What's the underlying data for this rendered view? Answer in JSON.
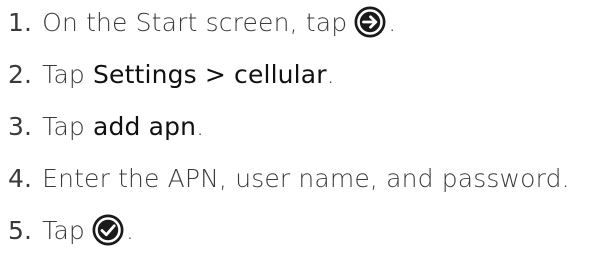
{
  "steps": [
    {
      "number": "1.",
      "text_before": "On the Start screen, tap",
      "icon": "arrow-right-circle-icon",
      "text_after": "."
    },
    {
      "number": "2.",
      "text_before": "Tap ",
      "emphasis": "Settings > cellular",
      "text_after": "."
    },
    {
      "number": "3.",
      "text_before": "Tap ",
      "emphasis": "add apn",
      "text_after": "."
    },
    {
      "number": "4.",
      "text": "Enter the APN, user name, and password."
    },
    {
      "number": "5.",
      "text_before": "Tap",
      "icon": "checkmark-circle-icon",
      "text_after": "."
    }
  ],
  "colors": {
    "text": "#3a3a3a",
    "emphasis": "#111111",
    "icon_fill": "#1a1a1a"
  }
}
